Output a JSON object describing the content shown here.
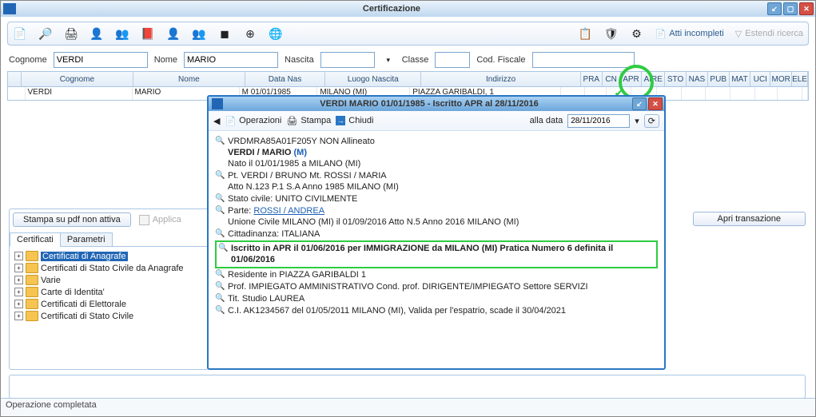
{
  "window": {
    "title": "Certificazione"
  },
  "toolbar": {
    "atti_incompleti": "Atti incompleti",
    "estendi_ricerca": "Estendi ricerca"
  },
  "filters": {
    "cognome_label": "Cognome",
    "cognome_value": "VERDI",
    "nome_label": "Nome",
    "nome_value": "MARIO",
    "nascita_label": "Nascita",
    "nascita_value": "",
    "classe_label": "Classe",
    "classe_value": "",
    "codfisc_label": "Cod. Fiscale",
    "codfisc_value": ""
  },
  "grid": {
    "headers": [
      "Cognome",
      "Nome",
      "Data Nas",
      "Luogo Nascita",
      "Indirizzo",
      "PRA",
      "CN",
      "APR",
      "AIRE",
      "STO",
      "NAS",
      "PUB",
      "MAT",
      "UCI",
      "MOR",
      "ELE"
    ],
    "row": {
      "cognome": "VERDI",
      "nome": "MARIO",
      "sesso": "M",
      "data_nas": "01/01/1985",
      "luogo_nascita": "MILANO (MI)",
      "indirizzo": "PIAZZA GARIBALDI, 1"
    }
  },
  "left_panel": {
    "stampa_btn": "Stampa su pdf non attiva",
    "applica": "Applica",
    "tab_certificati": "Certificati",
    "tab_parametri": "Parametri",
    "tree": [
      "Certificati di Anagrafe",
      "Certificati di Stato Civile da Anagrafe",
      "Varie",
      "Carte di Identita'",
      "Certificati di Elettorale",
      "Certificati di Stato Civile"
    ]
  },
  "right_panel": {
    "apri_trans": "Apri transazione"
  },
  "modal": {
    "title": "VERDI MARIO 01/01/1985 - Iscritto APR al 28/11/2016",
    "op_label": "Operazioni",
    "stampa_label": "Stampa",
    "chiudi_label": "Chiudi",
    "alla_data_label": "alla data",
    "alla_data_value": "28/11/2016",
    "lines": {
      "l1": "VRDMRA85A01F205Y NON Allineato",
      "l2a": "VERDI / MARIO",
      "l2b": "(M)",
      "l3": "Nato il 01/01/1985 a MILANO (MI)",
      "l4": "Pt. VERDI / BRUNO Mt. ROSSI / MARIA",
      "l5": "Atto N.123 P.1 S.A Anno 1985 MILANO (MI)",
      "l6": "Stato civile: UNITO CIVILMENTE",
      "l7a": "Parte: ",
      "l7b": "ROSSI / ANDREA",
      "l8": "Unione Civile MILANO (MI) il 01/09/2016 Atto N.5 Anno 2016 MILANO (MI)",
      "l9": "Cittadinanza: ITALIANA",
      "l10": "Iscritto in APR il 01/06/2016 per IMMIGRAZIONE da MILANO (MI) Pratica Numero 6 definita il 01/06/2016",
      "l11": "Residente in PIAZZA GARIBALDI 1",
      "l12": "Prof. IMPIEGATO AMMINISTRATIVO Cond. prof. DIRIGENTE/IMPIEGATO Settore SERVIZI",
      "l13": "Tit. Studio LAUREA",
      "l14": "C.I. AK1234567 del 01/05/2011 MILANO (MI), Valida per l'espatrio, scade il 30/04/2021"
    }
  },
  "status": "Operazione completata"
}
